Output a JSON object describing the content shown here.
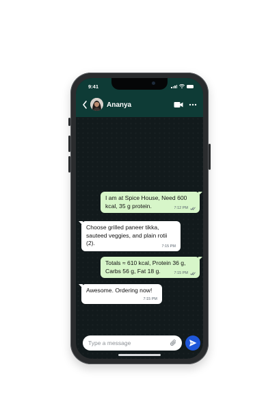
{
  "status_bar": {
    "time": "9:41"
  },
  "header": {
    "contact_name": "Ananya",
    "icons": {
      "back": "chevron-left-icon",
      "video": "video-camera-icon",
      "more": "more-horizontal-icon"
    },
    "color": "#0e3b36"
  },
  "messages": [
    {
      "direction": "outgoing",
      "text": "I am at Spice House, Need 600 kcal, 35 g protein.",
      "time": "7:12 PM",
      "status": "read"
    },
    {
      "direction": "incoming",
      "text": "Choose grilled paneer tikka, sauteed veggies, and plain rotii (2).",
      "time": "7:15 PM"
    },
    {
      "direction": "outgoing",
      "text": "Totals ≈ 610 kcal, Protein 36 g, Carbs 56 g, Fat 18 g.",
      "time": "7:15 PM",
      "status": "read"
    },
    {
      "direction": "incoming",
      "text": "Awesome. Ordering now!",
      "time": "7:15 PM"
    }
  ],
  "composer": {
    "placeholder": "Type a message",
    "value": "",
    "send_color": "#1f57d9"
  },
  "colors": {
    "outgoing_bubble": "#d7f6c9",
    "incoming_bubble": "#ffffff",
    "chat_background": "#121a1c"
  }
}
